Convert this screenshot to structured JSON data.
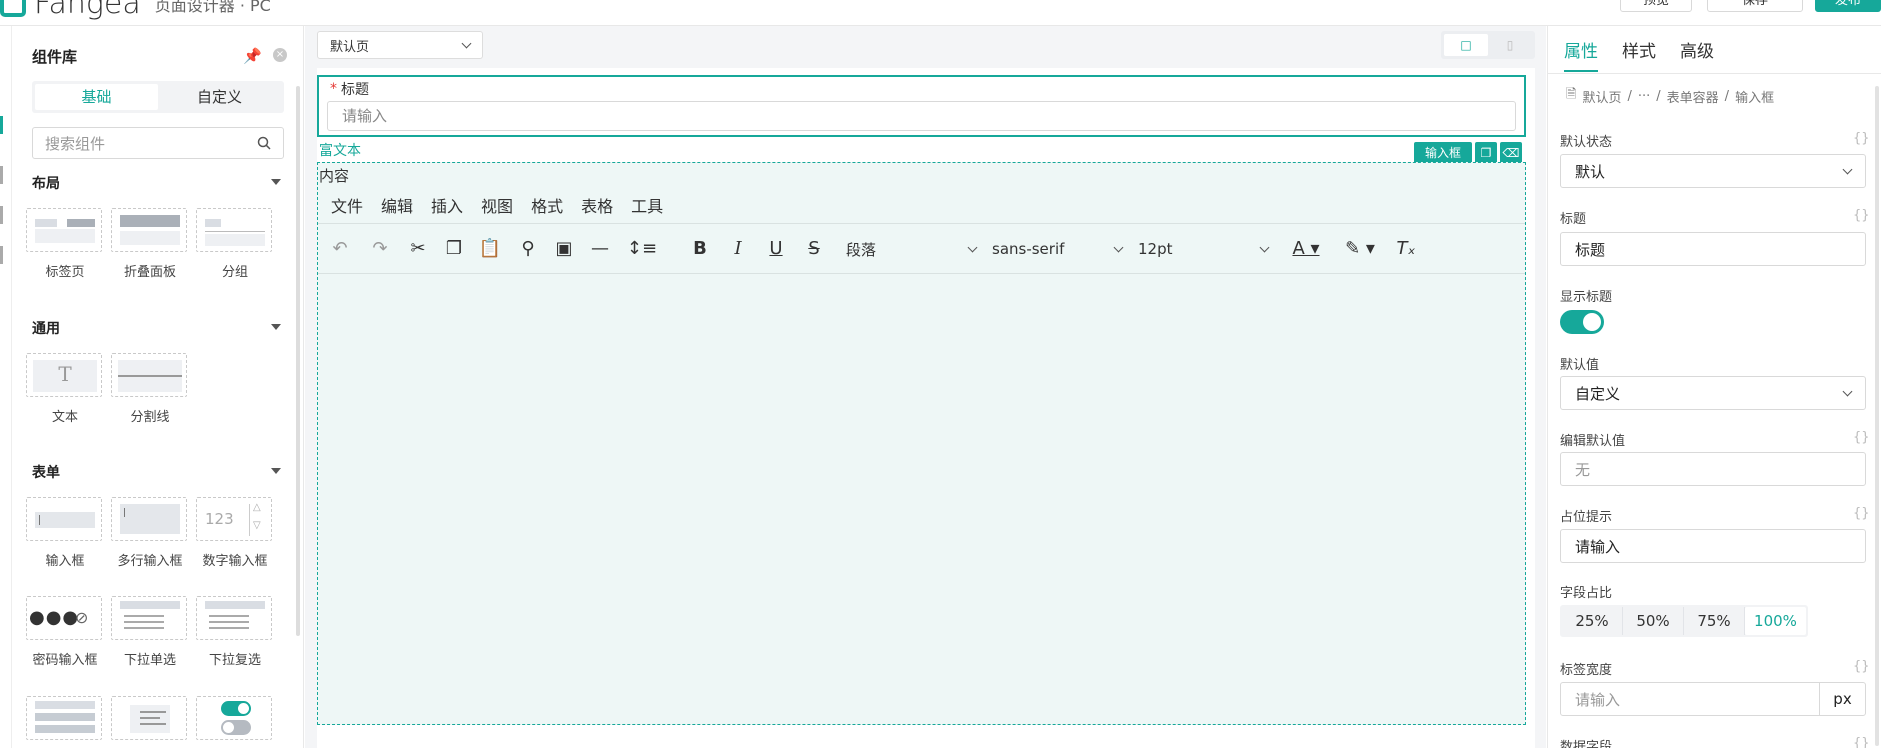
{
  "topbar": {
    "brand_name": "Fangea",
    "brand_sub": "页面设计器 · PC",
    "buttons": [
      "预览",
      "保存",
      "发布"
    ]
  },
  "left": {
    "title": "组件库",
    "tabs": [
      "基础",
      "自定义"
    ],
    "search_placeholder": "搜索组件",
    "sections": [
      {
        "title": "布局",
        "items": [
          "标签页",
          "折叠面板",
          "分组"
        ]
      },
      {
        "title": "通用",
        "items": [
          "文本",
          "分割线"
        ]
      },
      {
        "title": "表单",
        "items": [
          "输入框",
          "多行输入框",
          "数字输入框",
          "密码输入框",
          "下拉单选",
          "下拉复选"
        ]
      }
    ],
    "number_preview": "123",
    "text_preview": "T"
  },
  "center": {
    "page_select": "默认页",
    "title_field": {
      "required_mark": "*",
      "label": "标题",
      "placeholder": "请输入"
    },
    "rich_label": "富文本",
    "badge": "输入框",
    "rich_area": {
      "label": "内容",
      "menu": [
        "文件",
        "编辑",
        "插入",
        "视图",
        "格式",
        "表格",
        "工具"
      ],
      "format_select": "段落",
      "font_select": "sans-serif",
      "size_select": "12pt"
    }
  },
  "right": {
    "tabs": [
      "属性",
      "样式",
      "高级"
    ],
    "breadcrumb": [
      "默认页",
      "/",
      "···",
      "/",
      "表单容器",
      "/",
      "输入框"
    ],
    "curly": "{}",
    "default_state": {
      "label": "默认状态",
      "value": "默认"
    },
    "title": {
      "label": "标题",
      "value": "标题"
    },
    "show_title": {
      "label": "显示标题",
      "on": true
    },
    "default_value": {
      "label": "默认值",
      "value": "自定义"
    },
    "edit_default": {
      "label": "编辑默认值",
      "placeholder": "无"
    },
    "placeholder_hint": {
      "label": "占位提示",
      "value": "请输入"
    },
    "field_ratio": {
      "label": "字段占比",
      "options": [
        "25%",
        "50%",
        "75%",
        "100%"
      ],
      "selected": "100%"
    },
    "label_width": {
      "label": "标签宽度",
      "placeholder": "请输入",
      "unit": "px"
    },
    "data_field": {
      "label": "数据字段"
    }
  },
  "colors": {
    "accent": "#16a89a",
    "required": "#e53935"
  }
}
